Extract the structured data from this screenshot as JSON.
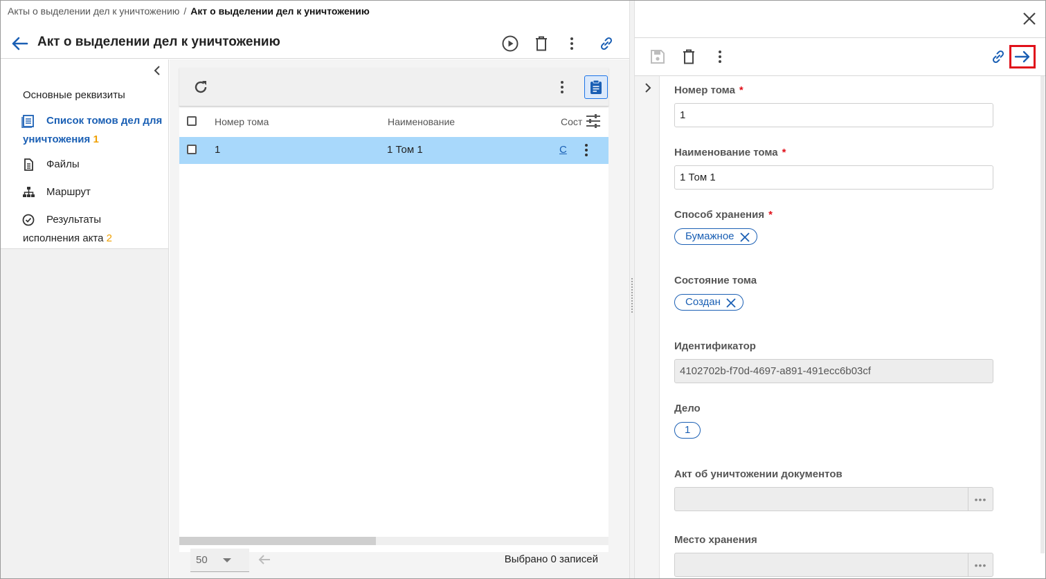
{
  "breadcrumb": {
    "parent": "Акты о выделении дел к уничтожению",
    "separator": "/",
    "current": "Акт о выделении дел к уничтожению"
  },
  "header": {
    "title": "Акт о выделении дел к уничтожению"
  },
  "sidebar": {
    "items": [
      {
        "label": "Основные реквизиты",
        "icon": "none",
        "count": ""
      },
      {
        "label_line1": "Список томов дел для",
        "label_line2": "уничтожения",
        "icon": "list-icon",
        "count": "1",
        "active": true
      },
      {
        "label": "Файлы",
        "icon": "document-icon",
        "count": ""
      },
      {
        "label": "Маршрут",
        "icon": "hierarchy-icon",
        "count": ""
      },
      {
        "label_line1": "Результаты",
        "label_line2": "исполнения акта",
        "icon": "check-badge-icon",
        "count": "2"
      }
    ]
  },
  "table": {
    "columns": [
      "Номер тома",
      "Наименование",
      "Сост"
    ],
    "rows": [
      {
        "number": "1",
        "name": "1 Том 1",
        "state": "С"
      }
    ],
    "page_size": "50",
    "selected_text": "Выбрано 0 записей"
  },
  "form": {
    "volume_number": {
      "label": "Номер тома",
      "value": "1",
      "required": "*"
    },
    "volume_name": {
      "label": "Наименование тома",
      "value": "1 Том 1",
      "required": "*"
    },
    "storage_method": {
      "label": "Способ хранения",
      "chip": "Бумажное",
      "required": "*"
    },
    "volume_state": {
      "label": "Состояние тома",
      "chip": "Создан"
    },
    "identifier": {
      "label": "Идентификатор",
      "value": "4102702b-f70d-4697-a891-491ecc6b03cf"
    },
    "case": {
      "label": "Дело",
      "chip": "1"
    },
    "destruction_act": {
      "label": "Акт об уничтожении документов",
      "value": ""
    },
    "storage_place": {
      "label": "Место хранения",
      "value": ""
    }
  },
  "colors": {
    "accent": "#1a5fb4",
    "selected_row": "#a8d8fb",
    "count": "#f0a000",
    "highlight_border": "#e0101a"
  }
}
